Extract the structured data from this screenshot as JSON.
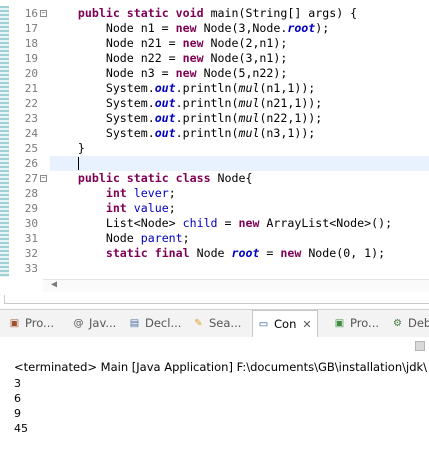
{
  "editor": {
    "line_numbers": [
      "16",
      "17",
      "18",
      "19",
      "20",
      "21",
      "22",
      "23",
      "24",
      "25",
      "26",
      "27",
      "28",
      "29",
      "30",
      "31",
      "32",
      "33"
    ],
    "lines": [
      [
        {
          "t": "    "
        },
        {
          "t": "public",
          "c": "kw"
        },
        {
          "t": " "
        },
        {
          "t": "static",
          "c": "kw"
        },
        {
          "t": " "
        },
        {
          "t": "void",
          "c": "kw"
        },
        {
          "t": " main(String[] args) {"
        }
      ],
      [
        {
          "t": "        Node n1 = "
        },
        {
          "t": "new",
          "c": "kw"
        },
        {
          "t": " Node(3,Node."
        },
        {
          "t": "root",
          "c": "st"
        },
        {
          "t": ");"
        }
      ],
      [
        {
          "t": "        Node n21 = "
        },
        {
          "t": "new",
          "c": "kw"
        },
        {
          "t": " Node(2,n1);"
        }
      ],
      [
        {
          "t": "        Node n22 = "
        },
        {
          "t": "new",
          "c": "kw"
        },
        {
          "t": " Node(3,n1);"
        }
      ],
      [
        {
          "t": "        Node n3 = "
        },
        {
          "t": "new",
          "c": "kw"
        },
        {
          "t": " Node(5,n22);"
        }
      ],
      [
        {
          "t": "        System."
        },
        {
          "t": "out",
          "c": "st"
        },
        {
          "t": ".println("
        },
        {
          "t": "mul",
          "c": "it"
        },
        {
          "t": "(n1,1));"
        }
      ],
      [
        {
          "t": "        System."
        },
        {
          "t": "out",
          "c": "st"
        },
        {
          "t": ".println("
        },
        {
          "t": "mul",
          "c": "it"
        },
        {
          "t": "(n21,1));"
        }
      ],
      [
        {
          "t": "        System."
        },
        {
          "t": "out",
          "c": "st"
        },
        {
          "t": ".println("
        },
        {
          "t": "mul",
          "c": "it"
        },
        {
          "t": "(n22,1));"
        }
      ],
      [
        {
          "t": "        System."
        },
        {
          "t": "out",
          "c": "st"
        },
        {
          "t": ".println("
        },
        {
          "t": "mul",
          "c": "it"
        },
        {
          "t": "(n3,1));"
        }
      ],
      [
        {
          "t": "    }"
        }
      ],
      [
        {
          "t": ""
        }
      ],
      [
        {
          "t": "    "
        },
        {
          "t": "public",
          "c": "kw"
        },
        {
          "t": " "
        },
        {
          "t": "static",
          "c": "kw"
        },
        {
          "t": " "
        },
        {
          "t": "class",
          "c": "kw"
        },
        {
          "t": " Node{"
        }
      ],
      [
        {
          "t": "        "
        },
        {
          "t": "int",
          "c": "kw"
        },
        {
          "t": " "
        },
        {
          "t": "lever",
          "c": "fi"
        },
        {
          "t": ";"
        }
      ],
      [
        {
          "t": "        "
        },
        {
          "t": "int",
          "c": "kw"
        },
        {
          "t": " "
        },
        {
          "t": "value",
          "c": "fi"
        },
        {
          "t": ";"
        }
      ],
      [
        {
          "t": "        List<Node> "
        },
        {
          "t": "child",
          "c": "fi"
        },
        {
          "t": " = "
        },
        {
          "t": "new",
          "c": "kw"
        },
        {
          "t": " ArrayList<Node>();"
        }
      ],
      [
        {
          "t": "        Node "
        },
        {
          "t": "parent",
          "c": "fi"
        },
        {
          "t": ";"
        }
      ],
      [
        {
          "t": "        "
        },
        {
          "t": "static",
          "c": "kw"
        },
        {
          "t": " "
        },
        {
          "t": "final",
          "c": "kw"
        },
        {
          "t": " Node "
        },
        {
          "t": "root",
          "c": "st"
        },
        {
          "t": " = "
        },
        {
          "t": "new",
          "c": "kw"
        },
        {
          "t": " Node(0, 1);"
        }
      ],
      [
        {
          "t": ""
        }
      ]
    ],
    "fold_markers": {
      "0": "−",
      "11": "−"
    },
    "current_line_index": 10
  },
  "tabs": [
    {
      "label": "Pro...",
      "icon": "problems-icon",
      "glyph": "▣",
      "color": "#a0522d"
    },
    {
      "label": "Jav...",
      "icon": "javadoc-icon",
      "glyph": "@",
      "color": "#555555"
    },
    {
      "label": "Decl...",
      "icon": "declaration-icon",
      "glyph": "▤",
      "color": "#4a6fa5"
    },
    {
      "label": "Sea...",
      "icon": "search-icon",
      "glyph": "✎",
      "color": "#e0a030"
    },
    {
      "label": "Con",
      "icon": "console-icon",
      "glyph": "▭",
      "color": "#1f4f8f",
      "active": true
    },
    {
      "label": "Pro...",
      "icon": "progress-icon",
      "glyph": "▣",
      "color": "#3c8c3c"
    },
    {
      "label": "Deb",
      "icon": "debug-icon",
      "glyph": "⚙",
      "color": "#3c7a3c"
    }
  ],
  "console": {
    "terminated": "<terminated> Main [Java Application] F:\\documents\\GB\\installation\\jdk\\",
    "output": [
      "3",
      "6",
      "9",
      "45"
    ]
  }
}
